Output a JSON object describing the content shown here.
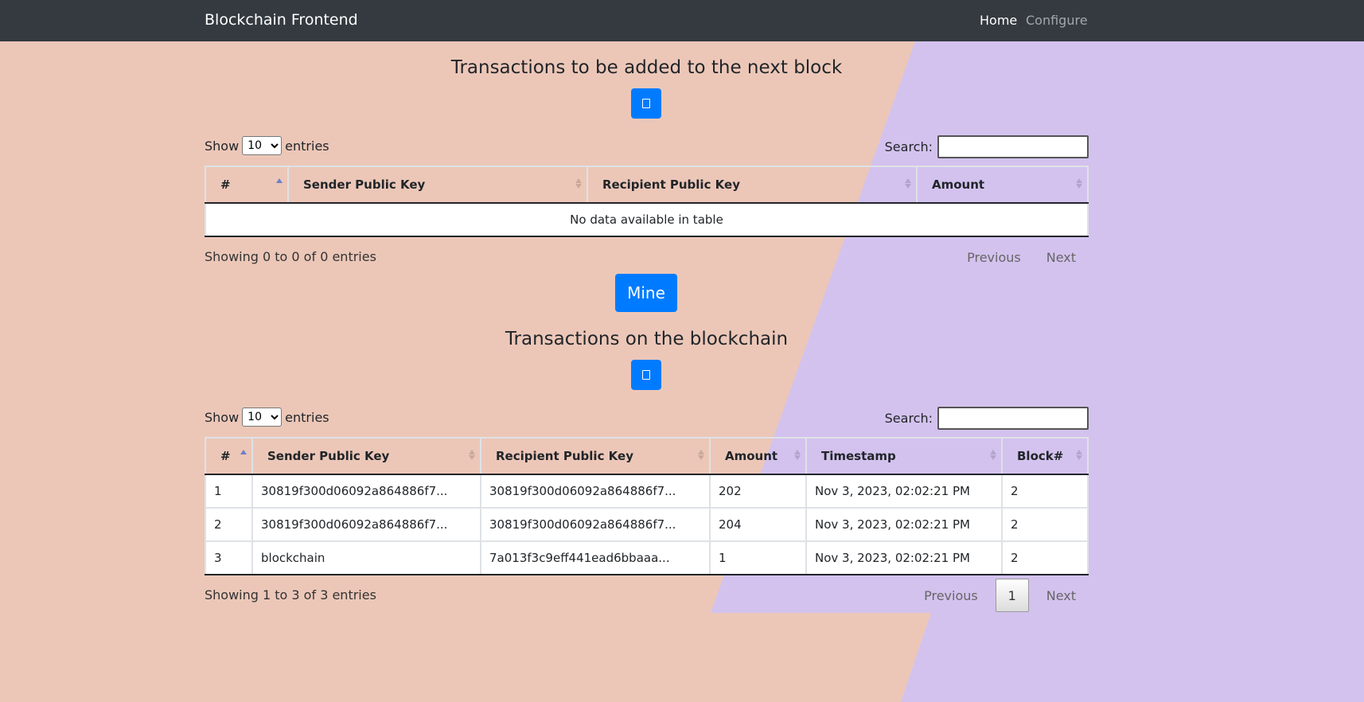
{
  "navbar": {
    "brand": "Blockchain Frontend",
    "links": [
      {
        "label": "Home",
        "active": true
      },
      {
        "label": "Configure",
        "active": false
      }
    ]
  },
  "pending": {
    "title": "Transactions to be added to the next block",
    "refresh_icon": "refresh-icon",
    "show_label": "Show",
    "entries_label": "entries",
    "page_length": "10",
    "search_label": "Search:",
    "search_value": "",
    "columns": [
      "#",
      "Sender Public Key",
      "Recipient Public Key",
      "Amount"
    ],
    "empty_message": "No data available in table",
    "info": "Showing 0 to 0 of 0 entries",
    "prev_label": "Previous",
    "next_label": "Next"
  },
  "mine_button": "Mine",
  "chain": {
    "title": "Transactions on the blockchain",
    "refresh_icon": "refresh-icon",
    "show_label": "Show",
    "entries_label": "entries",
    "page_length": "10",
    "search_label": "Search:",
    "search_value": "",
    "columns": [
      "#",
      "Sender Public Key",
      "Recipient Public Key",
      "Amount",
      "Timestamp",
      "Block#"
    ],
    "rows": [
      [
        "1",
        "30819f300d06092a864886f7...",
        "30819f300d06092a864886f7...",
        "202",
        "Nov 3, 2023, 02:02:21 PM",
        "2"
      ],
      [
        "2",
        "30819f300d06092a864886f7...",
        "30819f300d06092a864886f7...",
        "204",
        "Nov 3, 2023, 02:02:21 PM",
        "2"
      ],
      [
        "3",
        "blockchain",
        "7a013f3c9eff441ead6bbaaa...",
        "1",
        "Nov 3, 2023, 02:02:21 PM",
        "2"
      ]
    ],
    "info": "Showing 1 to 3 of 3 entries",
    "prev_label": "Previous",
    "current_page": "1",
    "next_label": "Next"
  },
  "colors": {
    "navbar": "#343a40",
    "background_left": "#ecc7b8",
    "background_right": "#d3c2ee",
    "primary": "#007bff"
  }
}
